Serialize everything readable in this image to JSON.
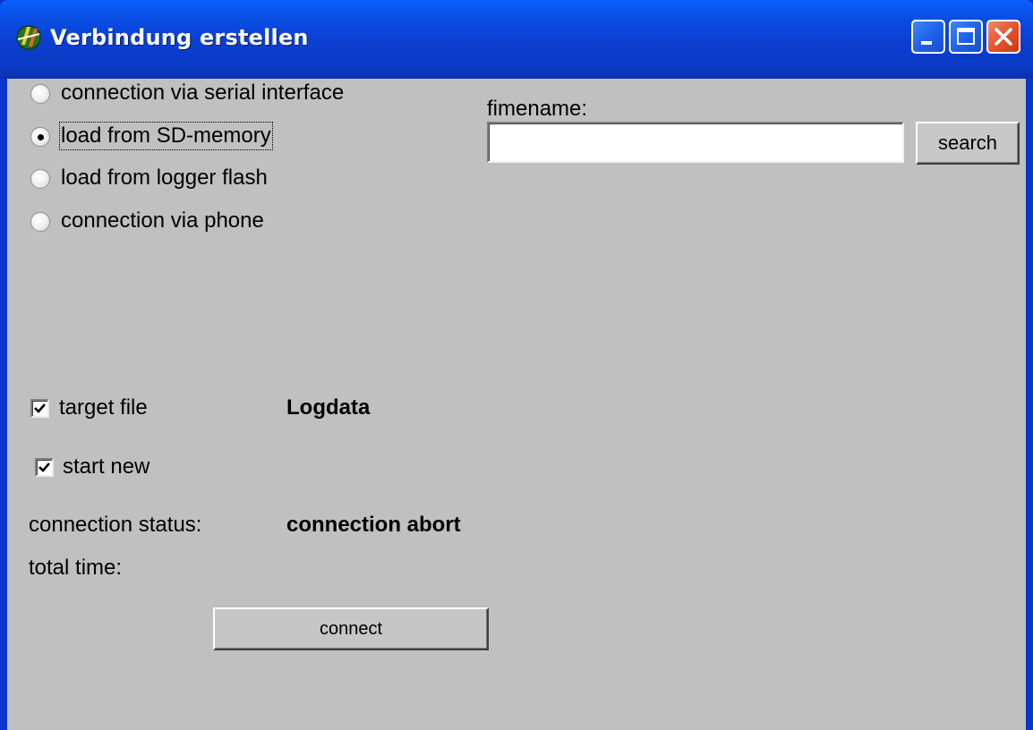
{
  "window": {
    "title": "Verbindung erstellen"
  },
  "connection_options": [
    {
      "label": "connection via serial interface",
      "selected": false
    },
    {
      "label": "load from SD-memory",
      "selected": true
    },
    {
      "label": "load from logger flash",
      "selected": false
    },
    {
      "label": "connection via phone",
      "selected": false
    }
  ],
  "file": {
    "label": "fimename:",
    "value": "",
    "search_label": "search"
  },
  "target_file": {
    "label": "target file",
    "checked": true,
    "value": "Logdata"
  },
  "start_new": {
    "label": "start new",
    "checked": true
  },
  "status": {
    "label": "connection status:",
    "value": "connection abort",
    "total_time_label": "total time:"
  },
  "actions": {
    "connect_label": "connect"
  },
  "colors": {
    "titlebar": "#0b3fd0",
    "client_bg": "#c0c0c0",
    "close_button": "#e1502a"
  }
}
